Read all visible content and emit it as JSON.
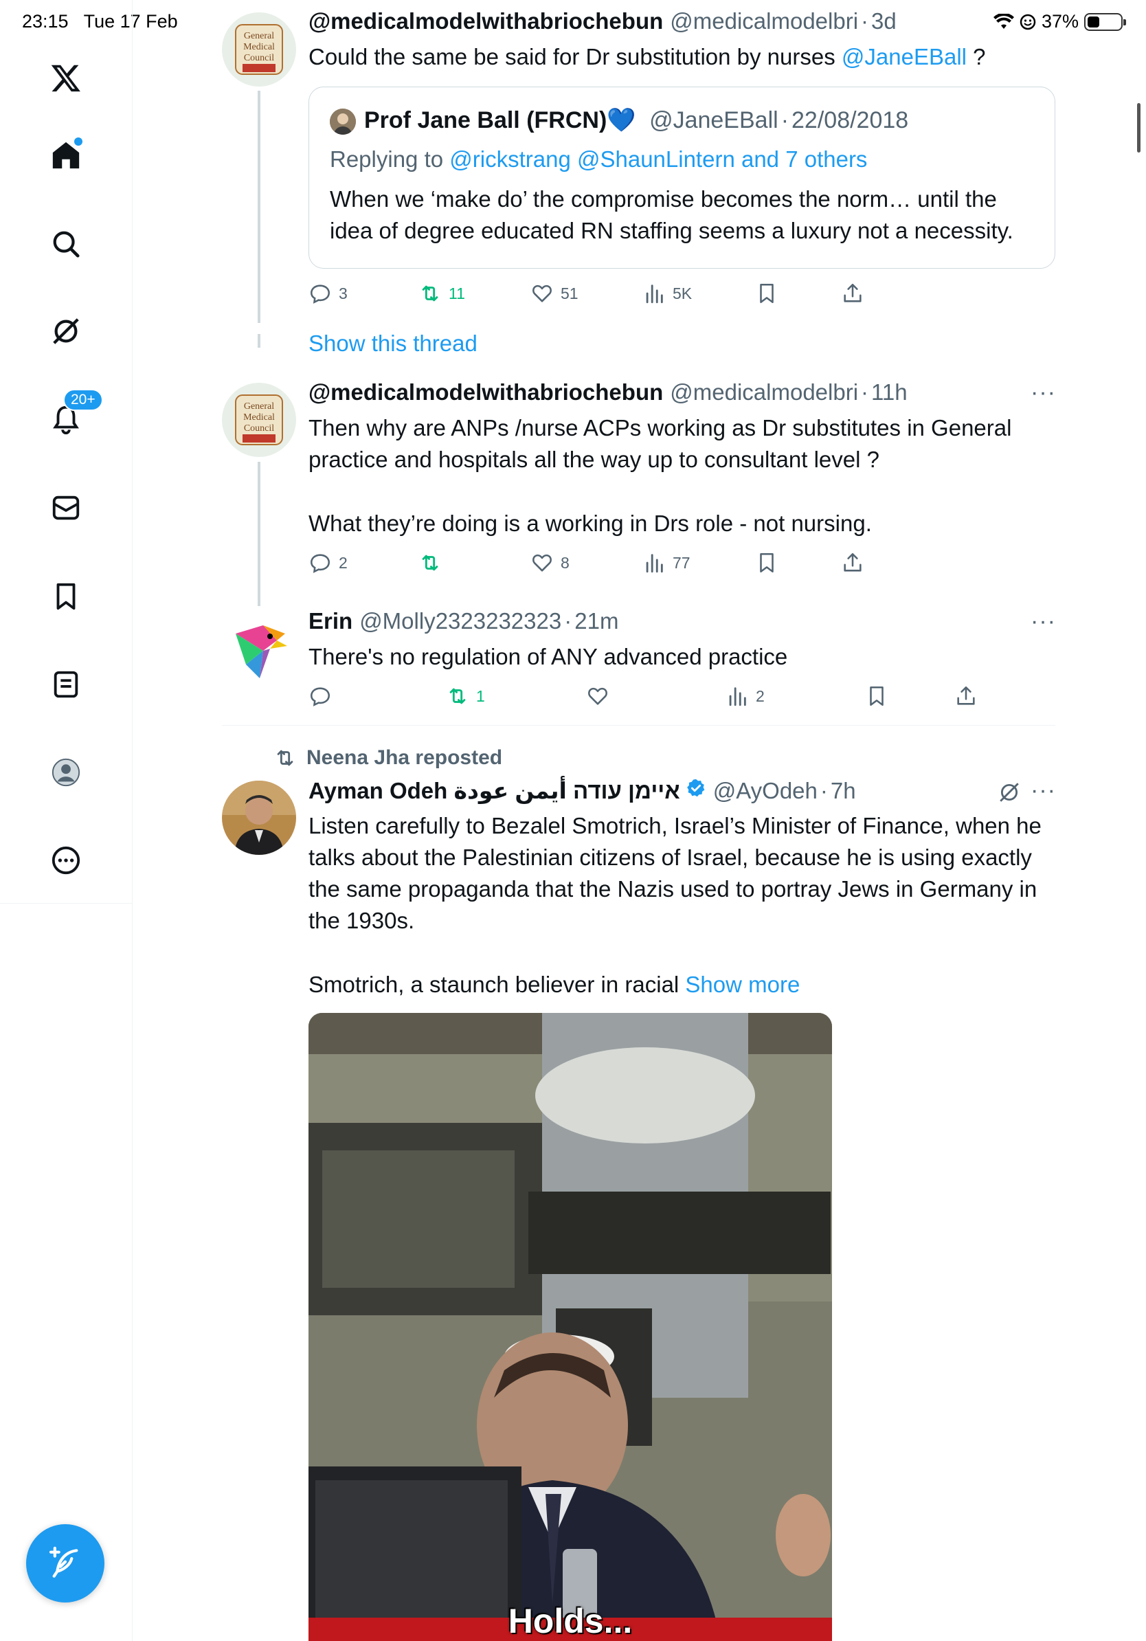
{
  "status_bar": {
    "time": "23:15",
    "date": "Tue 17 Feb",
    "battery": "37%",
    "battery_fraction": 0.37
  },
  "sidebar": {
    "items": [
      {
        "name": "x-logo"
      },
      {
        "name": "home"
      },
      {
        "name": "explore"
      },
      {
        "name": "grok"
      },
      {
        "name": "notifications",
        "badge": "20+"
      },
      {
        "name": "messages"
      },
      {
        "name": "bookmarks"
      },
      {
        "name": "lists"
      },
      {
        "name": "profile"
      },
      {
        "name": "more"
      }
    ],
    "compose_icon": "feather-plus-icon"
  },
  "colors": {
    "accent": "#1d9bf0",
    "text": "#0f1419",
    "secondary": "#536471",
    "repost_green": "#00ba7c",
    "border": "#cfd9de"
  },
  "tweets": [
    {
      "name": "@medicalmodelwithabriochebun",
      "handle": "@medicalmodelbri",
      "time": "3d",
      "text_prefix": "Could the same be said for Dr substitution by nurses ",
      "text_mention": "@JaneEBall",
      "text_suffix": " ?",
      "quote": {
        "name": "Prof Jane Ball (FRCN)",
        "emoji": "💙",
        "handle": "@JaneEBall",
        "date": "22/08/2018",
        "replying_label": "Replying to ",
        "replying_to": "@rickstrang @ShaunLintern and 7 others",
        "text": "When we ‘make do’ the compromise becomes the norm… until the idea of degree educated RN staffing seems a luxury not a necessity."
      },
      "stats": {
        "replies": "3",
        "reposts": "11",
        "likes": "51",
        "views": "5K"
      },
      "show_thread": "Show this thread"
    },
    {
      "name": "@medicalmodelwithabriochebun",
      "handle": "@medicalmodelbri",
      "time": "11h",
      "text_1": "Then why are ANPs /nurse ACPs  working as Dr substitutes in General practice and hospitals all the way up to consultant level ?",
      "text_2": "What they’re doing is a working in Drs role - not nursing.",
      "stats": {
        "replies": "2",
        "reposts": "",
        "likes": "8",
        "views": "77"
      }
    },
    {
      "name": "Erin",
      "handle": "@Molly2323232323",
      "time": "21m",
      "text": "There's no regulation of ANY advanced practice",
      "stats": {
        "replies": "",
        "reposts": "1",
        "likes": "",
        "views": "2"
      }
    },
    {
      "reposted_by": "Neena Jha reposted",
      "name": "Ayman Odeh איימן עודה أيمن عودة",
      "handle": "@AyOdeh",
      "time": "7h",
      "text_1": "Listen carefully to Bezalel Smotrich, Israel’s Minister of Finance, when he talks about the Palestinian citizens of Israel, because he is using exactly the same propaganda that the Nazis used to portray Jews in Germany in the 1930s.",
      "text_2": "Smotrich, a staunch believer in racial ",
      "show_more": "Show more",
      "video_caption": "Holds..."
    }
  ]
}
